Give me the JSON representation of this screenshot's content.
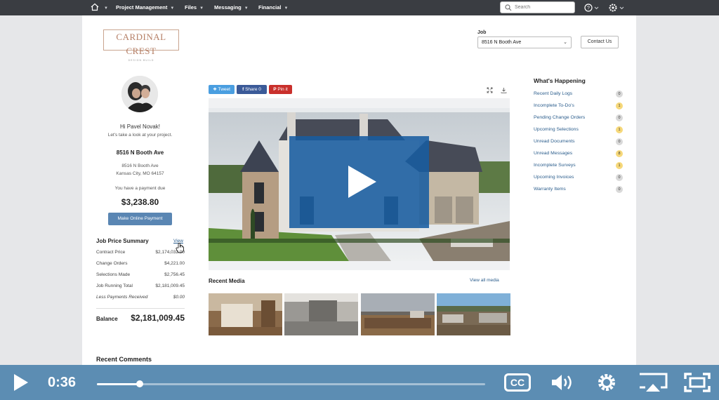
{
  "nav": {
    "items": [
      "Project Management",
      "Files",
      "Messaging",
      "Financial"
    ],
    "search_placeholder": "Search"
  },
  "header": {
    "logo_line1": "CARDINAL CREST",
    "logo_line2": "DESIGN BUILD",
    "job_label": "Job",
    "job_value": "8516 N Booth Ave",
    "contact_label": "Contact Us"
  },
  "profile": {
    "greeting": "Hi Pavel Novak!",
    "subtext": "Let's take a look at your project.",
    "address_title": "8516 N Booth Ave",
    "address_line1": "8516 N Booth Ave",
    "address_line2": "Kansas City, MO 64157",
    "payment_due": "You have a payment due",
    "payment_amount": "$3,238.80",
    "payment_button": "Make Online Payment"
  },
  "job_price": {
    "title": "Job Price Summary",
    "view_label": "View",
    "rows": [
      {
        "label": "Contract Price",
        "value": "$2,174,032.00"
      },
      {
        "label": "Change Orders",
        "value": "$4,221.00"
      },
      {
        "label": "Selections Made",
        "value": "$2,756.45"
      },
      {
        "label": "Job Running Total",
        "value": "$2,181,009.45"
      },
      {
        "label": "Less Payments Received",
        "value": "$0.00"
      }
    ],
    "balance_label": "Balance",
    "balance_value": "$2,181,009.45"
  },
  "recent_comments_title": "Recent Comments",
  "share": {
    "tweet": "Tweet",
    "facebook": "Share 0",
    "pin": "Pin it"
  },
  "media": {
    "title": "Recent Media",
    "view_all": "View all media"
  },
  "whats_happening": {
    "title": "What's Happening",
    "items": [
      {
        "label": "Recent Daily Logs",
        "count": "0",
        "color": "#d9d9d9"
      },
      {
        "label": "Incomplete To-Do's",
        "count": "1",
        "color": "#f6d87a"
      },
      {
        "label": "Pending Change Orders",
        "count": "0",
        "color": "#d9d9d9"
      },
      {
        "label": "Upcoming Selections",
        "count": "1",
        "color": "#f6d87a"
      },
      {
        "label": "Unread Documents",
        "count": "0",
        "color": "#d9d9d9"
      },
      {
        "label": "Unread Messages",
        "count": "8",
        "color": "#f6d87a"
      },
      {
        "label": "Incomplete Surveys",
        "count": "1",
        "color": "#f6d87a"
      },
      {
        "label": "Upcoming Invoices",
        "count": "0",
        "color": "#d9d9d9"
      },
      {
        "label": "Warranty Items",
        "count": "0",
        "color": "#d9d9d9"
      }
    ]
  },
  "player": {
    "time": "0:36",
    "progress": 0.11,
    "cc_label": "CC"
  }
}
